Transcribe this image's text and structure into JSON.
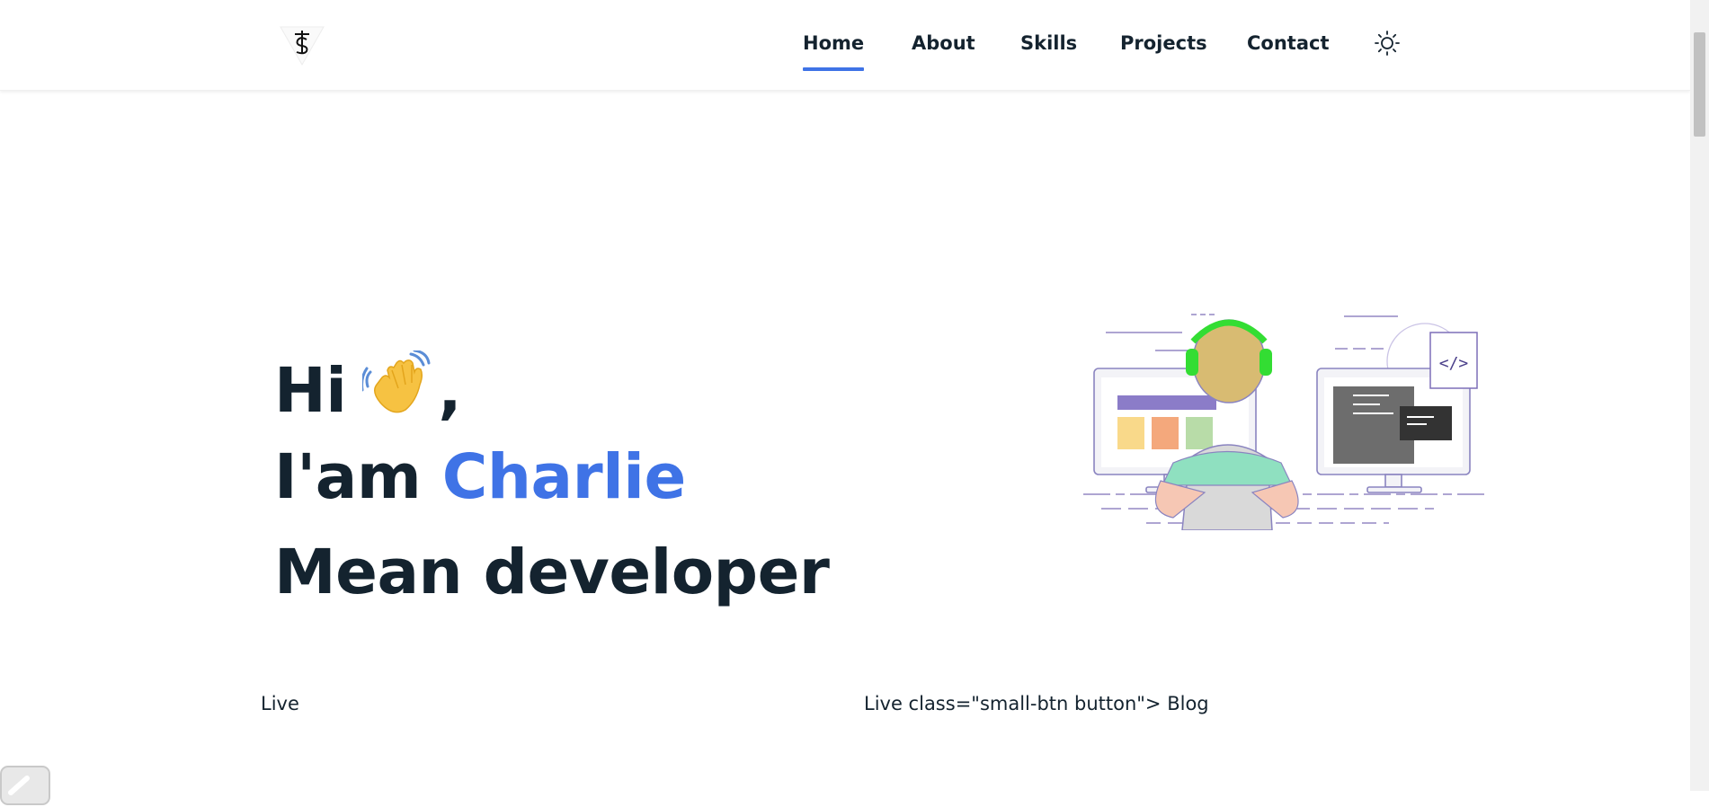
{
  "nav": {
    "logo_icon": "ts-monogram-logo",
    "links": [
      {
        "label": "Home",
        "active": true
      },
      {
        "label": "About",
        "active": false
      },
      {
        "label": "Skills",
        "active": false
      },
      {
        "label": "Projects",
        "active": false
      },
      {
        "label": "Contact",
        "active": false
      }
    ],
    "theme_icon": "sun-icon"
  },
  "hero": {
    "greeting": "Hi",
    "greeting_suffix": ",",
    "wave_icon": "waving-hand-icon",
    "intro_prefix": "I'am",
    "name": "Charlie",
    "role": "Mean developer",
    "illustration": "developer-at-computers-illustration"
  },
  "links_row": {
    "left_text": "Live",
    "right_text": "Live class=\"small-btn button\"> Blog"
  },
  "colors": {
    "accent": "#3f73e6",
    "text": "#14232f"
  }
}
